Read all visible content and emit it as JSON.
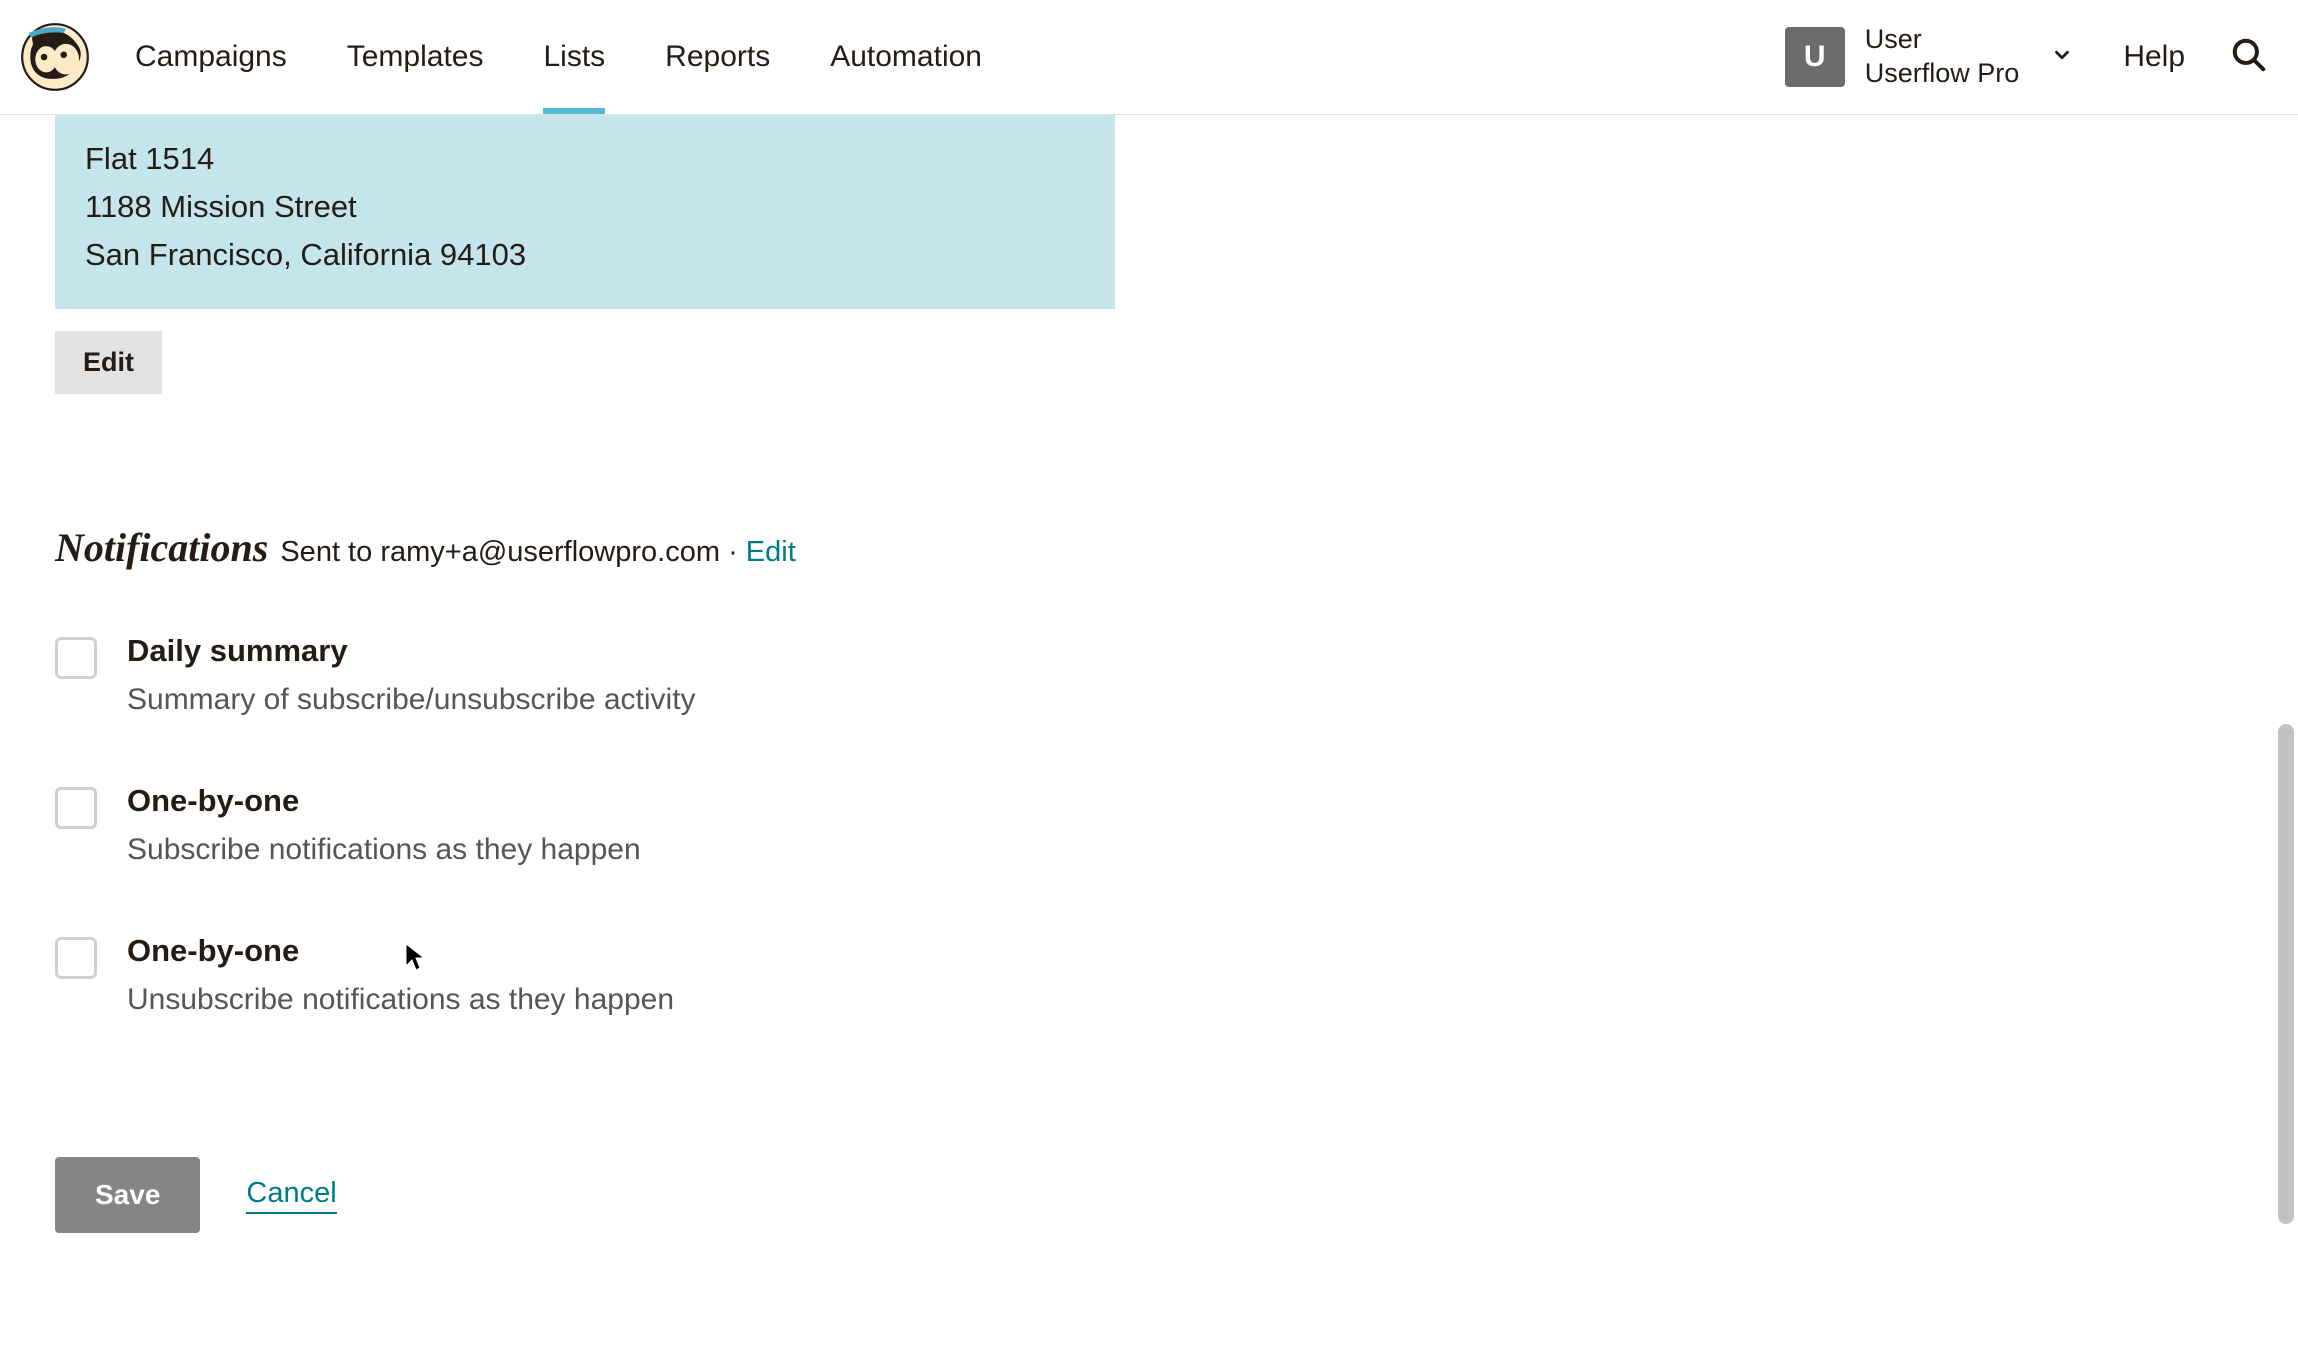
{
  "nav": {
    "items": [
      "Campaigns",
      "Templates",
      "Lists",
      "Reports",
      "Automation"
    ],
    "active_index": 2
  },
  "user": {
    "initial": "U",
    "name": "User",
    "org": "Userflow Pro"
  },
  "help_label": "Help",
  "address": {
    "line1": "Flat 1514",
    "line2": "1188 Mission Street",
    "line3": "San Francisco, California 94103"
  },
  "edit_button": "Edit",
  "notifications": {
    "heading": "Notifications",
    "sent_to_prefix": "Sent to ",
    "email": "ramy+a@userflowpro.com",
    "separator": " · ",
    "edit_link": "Edit",
    "items": [
      {
        "title": "Daily summary",
        "desc": "Summary of subscribe/unsubscribe activity"
      },
      {
        "title": "One-by-one",
        "desc": "Subscribe notifications as they happen"
      },
      {
        "title": "One-by-one",
        "desc": "Unsubscribe notifications as they happen"
      }
    ]
  },
  "actions": {
    "save": "Save",
    "cancel": "Cancel"
  }
}
